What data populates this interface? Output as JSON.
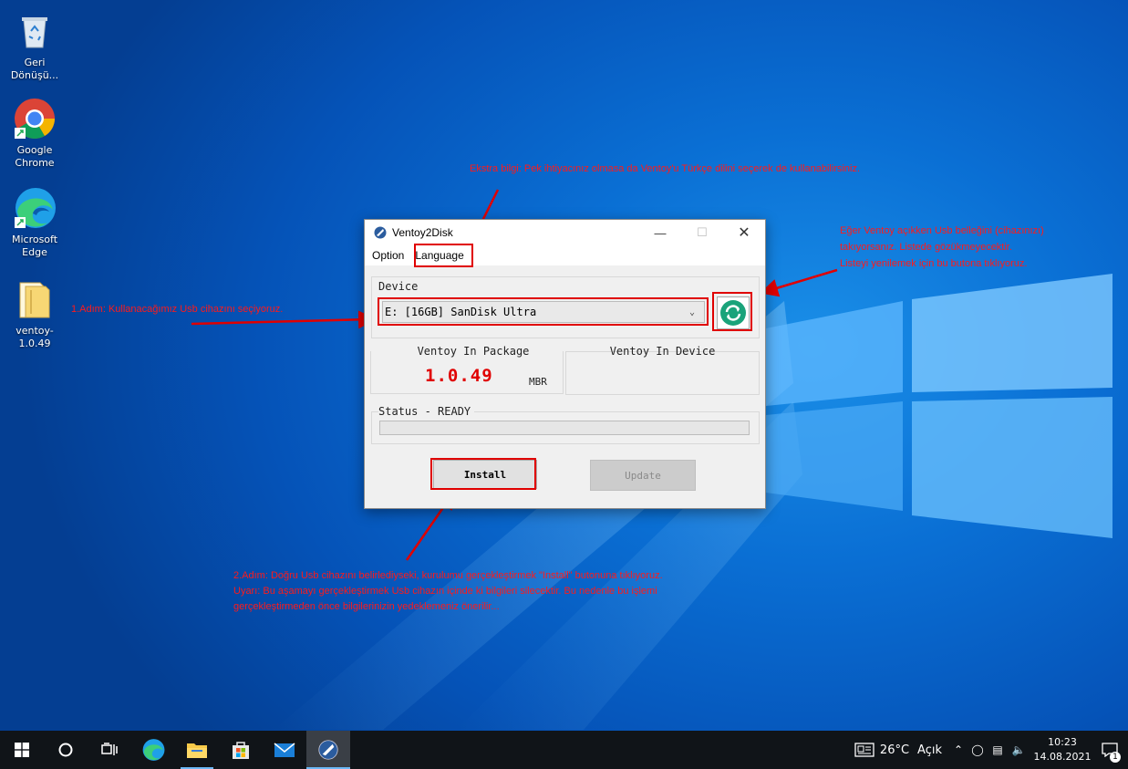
{
  "desktop": {
    "icons": [
      {
        "label": "Geri Dönüşü..."
      },
      {
        "label": "Google Chrome"
      },
      {
        "label": "Microsoft Edge"
      },
      {
        "label": "ventoy-1.0.49"
      }
    ]
  },
  "annotations": {
    "top": "Ekstra bilgi: Pek ihtiyacınız olmasa da Ventoy'u Türkçe dilini seçerek de kullanabilirsiniz.",
    "right_1": "Eğer Ventoy açıkken Usb belleğini (cihazınızı)",
    "right_2": "takıyorsanız. Listede gözükmeyecektir.",
    "right_3": "Listeyi yenilemek için bu butona tıklıyoruz.",
    "left": "1.Adım: Kullanacağımız Usb cihazını seçiyoruz.",
    "bottom_1": "2.Adım: Doğru Usb cihazını belirlediyseki, kurulumu gerçekleştirmek \"Install\" butonuna tıklıyoruz.",
    "bottom_2": "Uyarı: Bu aşamayı gerçekleştirmek Usb cihazın içinde ki bilgileri silecektir. Bu nedenle bu işlemi",
    "bottom_3": "gerçekleştirmeden önce bilgilerinizin yedeklemeniz önerilir..."
  },
  "window": {
    "title": "Ventoy2Disk",
    "menu": {
      "option": "Option",
      "language": "Language"
    },
    "device_label": "Device",
    "device_value": "E: [16GB] SanDisk Ultra",
    "package_label": "Ventoy In Package",
    "package_version": "1.0.49",
    "package_style": "MBR",
    "device_ventoy_label": "Ventoy In Device",
    "status_label": "Status - READY",
    "progress": 0,
    "install_label": "Install",
    "update_label": "Update",
    "colors": {
      "version": "#e00000",
      "refresh": "#1aa37a",
      "annotation": "#ff1a1a"
    }
  },
  "taskbar": {
    "weather_temp": "26°C",
    "weather_text": "Açık",
    "time": "10:23",
    "date": "14.08.2021",
    "notif_count": "1"
  }
}
